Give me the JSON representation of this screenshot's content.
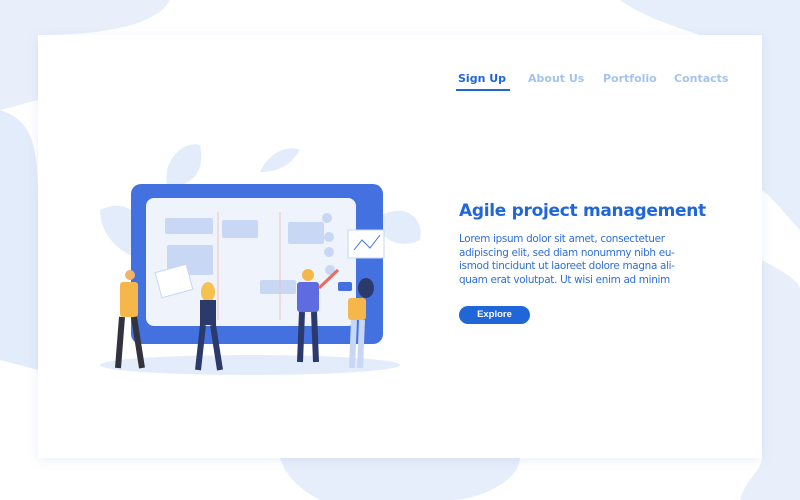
{
  "nav": {
    "items": [
      {
        "label": "Sign Up",
        "active": true
      },
      {
        "label": "About Us",
        "active": false
      },
      {
        "label": "Portfolio",
        "active": false
      },
      {
        "label": "Contacts",
        "active": false
      }
    ]
  },
  "hero": {
    "title": "Agile project management",
    "body": "Lorem ipsum dolor sit amet, consectetuer adipiscing elit, sed diam nonummy nibh eu-ismod tincidunt ut laoreet dolore magna ali-quam erat volutpat. Ut wisi enim ad minim",
    "button_label": "Explore"
  },
  "colors": {
    "accent": "#1f66d9",
    "nav_inactive": "#a6c3ee",
    "background_blob": "#e6eefb"
  }
}
